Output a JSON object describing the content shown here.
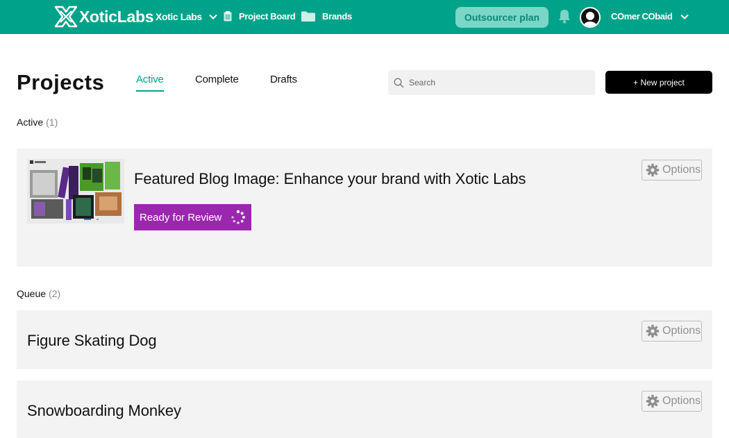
{
  "brand": {
    "name": "XoticLabs",
    "accent": "#00a389",
    "purple": "#9b27af"
  },
  "topnav": {
    "workspace": "Xotic Labs",
    "project_board": "Project Board",
    "brands": "Brands",
    "plan_button": "Outsourcer plan",
    "user_name": "COmer CObaid",
    "icons": {
      "board": "clipboard-icon",
      "brands": "folder-icon",
      "bell": "bell-icon",
      "avatar": "user-avatar",
      "chevron": "chevron-down-icon"
    }
  },
  "page": {
    "title": "Projects",
    "tabs": [
      {
        "label": "Active",
        "active": true
      },
      {
        "label": "Complete",
        "active": false
      },
      {
        "label": "Drafts",
        "active": false
      }
    ],
    "search_placeholder": "Search",
    "new_project": "+ New project"
  },
  "sections": {
    "active": {
      "label": "Active",
      "count": "(1)",
      "items": [
        {
          "title": "Featured Blog Image: Enhance your brand with Xotic Labs",
          "status": "Ready for Review",
          "options": "Options"
        }
      ]
    },
    "queue": {
      "label": "Queue",
      "count": "(2)",
      "items": [
        {
          "title": "Figure Skating Dog",
          "options": "Options"
        },
        {
          "title": "Snowboarding Monkey",
          "options": "Options"
        }
      ]
    }
  }
}
